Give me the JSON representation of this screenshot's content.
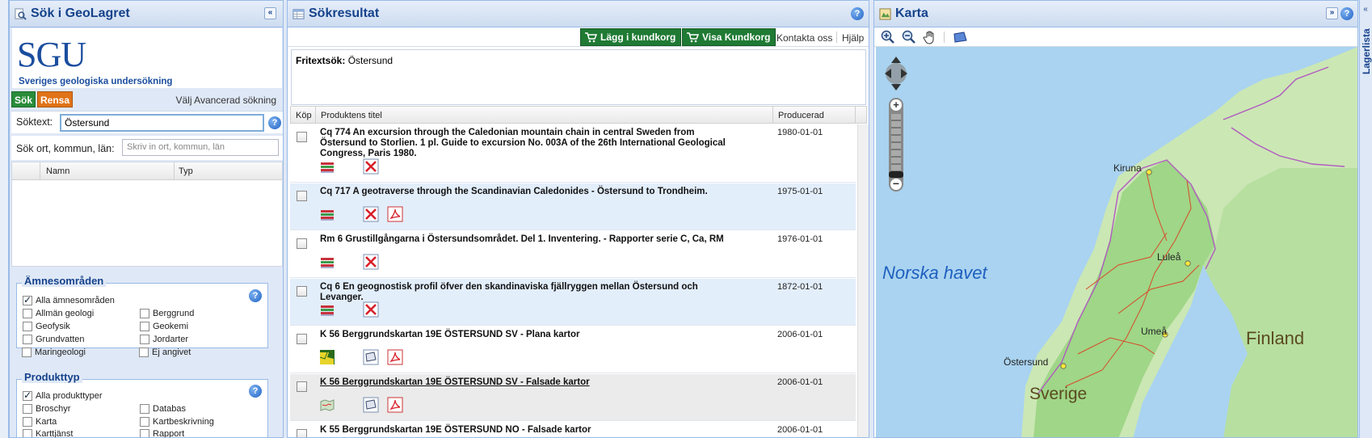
{
  "left": {
    "title": "Sök i GeoLagret",
    "logo_text": "SGU",
    "logo_subtitle": "Sveriges geologiska undersökning",
    "search_button": "Sök",
    "clear_button": "Rensa",
    "advanced_link": "Välj Avancerad sökning",
    "search_label": "Söktext:",
    "search_value": "Östersund",
    "place_label": "Sök ort, kommun, län:",
    "place_placeholder": "Skriv in ort, kommun, län",
    "grid_columns": [
      "Namn",
      "Typ"
    ],
    "subjects": {
      "legend": "Ämnesområden",
      "all": "Alla ämnesområden",
      "items": [
        "Allmän geologi",
        "Berggrund",
        "Geofysik",
        "Geokemi",
        "Grundvatten",
        "Jordarter",
        "Maringeologi",
        "Ej angivet"
      ]
    },
    "products": {
      "legend": "Produkttyp",
      "all": "Alla produkttyper",
      "items": [
        "Broschyr",
        "Databas",
        "Karta",
        "Kartbeskrivning",
        "Karttjänst",
        "Rapport"
      ]
    }
  },
  "middle": {
    "title": "Sökresultat",
    "add_to_cart": "Lägg i kundkorg",
    "show_cart": "Visa Kundkorg",
    "contact": "Kontakta oss",
    "help": "Hjälp",
    "freetext_label": "Fritextsök:",
    "freetext_value": "Östersund",
    "columns": [
      "Köp",
      "Produktens titel",
      "Producerad"
    ],
    "results": [
      {
        "title": "Cq 774 An excursion through the Caledonian mountain chain in central Sweden from Östersund to Storlien. 1 pl. Guide to excursion No. 003A of the 26th International Geological Congress, Paris 1980.",
        "date": "1980-01-01",
        "icons": [
          "book-icon",
          "no-map-icon"
        ]
      },
      {
        "title": "Cq 717 A geotraverse through the Scandinavian Caledonides - Östersund to Trondheim.",
        "date": "1975-01-01",
        "icons": [
          "book-icon",
          "no-map-icon",
          "pdf-icon"
        ]
      },
      {
        "title": "Rm 6 Grustillgångarna i Östersundsområdet. Del 1. Inventering. - Rapporter serie C, Ca, RM",
        "date": "1976-01-01",
        "icons": [
          "book-icon",
          "no-map-icon"
        ]
      },
      {
        "title": "Cq 6 En geognostisk profil öfver den skandinaviska fjällryggen mellan Östersund och Levanger.",
        "date": "1872-01-01",
        "icons": [
          "book-icon",
          "no-map-icon"
        ]
      },
      {
        "title": "K 56 Berggrundskartan 19E ÖSTERSUND SV - Plana kartor",
        "date": "2006-01-01",
        "icons": [
          "map-sheet-icon",
          "map-extent-icon",
          "pdf-icon"
        ]
      },
      {
        "title": "K 56 Berggrundskartan 19E ÖSTERSUND SV - Falsade kartor",
        "date": "2006-01-01",
        "icons": [
          "folded-map-icon",
          "map-extent-icon",
          "pdf-icon"
        ]
      },
      {
        "title": "K 55 Berggrundskartan 19E ÖSTERSUND NO - Falsade kartor",
        "date": "2006-01-01",
        "icons": []
      }
    ]
  },
  "right": {
    "title": "Karta",
    "side_tab": "Lagerlista",
    "labels": {
      "sea": "Norska havet",
      "finland": "Finland",
      "sweden": "Sverige",
      "kiruna": "Kiruna",
      "lulea": "Luleå",
      "umea": "Umeå",
      "ostersund": "Östersund"
    }
  },
  "colors": {
    "header_text": "#15428b",
    "green_button": "#1f7a34",
    "orange_button": "#e07318",
    "sea": "#a9d3f0",
    "land": "#9fd687"
  }
}
